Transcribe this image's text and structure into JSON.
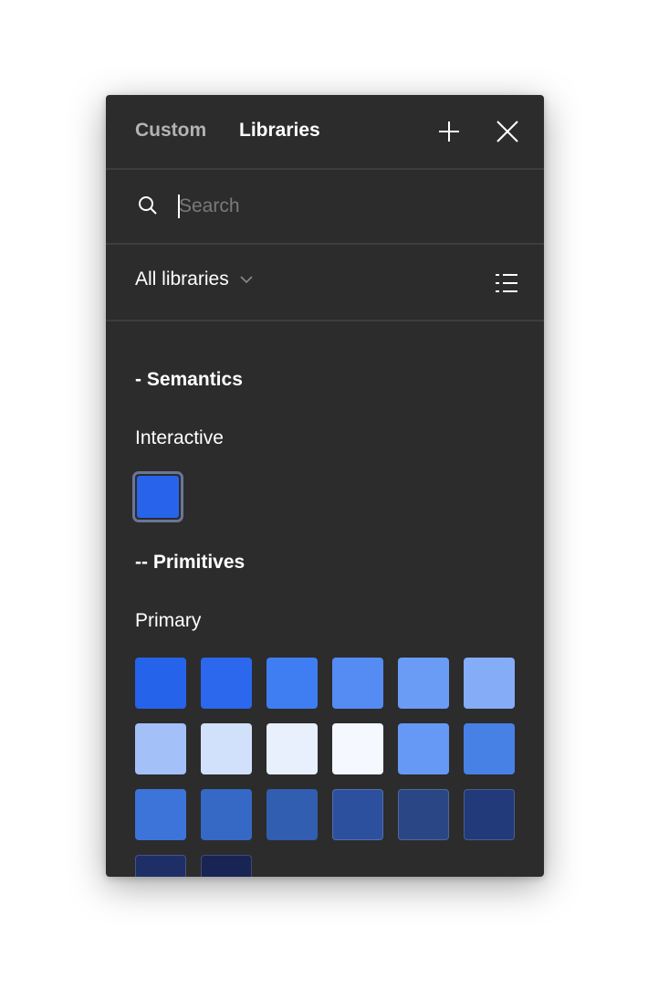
{
  "header": {
    "tabs": [
      {
        "label": "Custom",
        "active": false
      },
      {
        "label": "Libraries",
        "active": true
      }
    ],
    "add_icon": "plus-icon",
    "close_icon": "close-icon"
  },
  "search": {
    "placeholder": "Search",
    "value": "",
    "icon": "search-icon"
  },
  "filter": {
    "selected": "All libraries",
    "chevron_icon": "chevron-down-icon",
    "view_icon": "list-view-icon"
  },
  "groups": [
    {
      "title": "- Semantics",
      "subgroups": [
        {
          "title": "Interactive",
          "swatches": [
            {
              "color": "#2764eb",
              "selected": true
            }
          ]
        }
      ]
    },
    {
      "title": "-- Primitives",
      "subgroups": [
        {
          "title": "Primary",
          "swatches": [
            {
              "color": "#2563eb"
            },
            {
              "color": "#2b68ee"
            },
            {
              "color": "#3f7ef2"
            },
            {
              "color": "#558cf4"
            },
            {
              "color": "#6a9cf5"
            },
            {
              "color": "#84acf7"
            },
            {
              "color": "#a3c0f8"
            },
            {
              "color": "#d1e0fb"
            },
            {
              "color": "#e8effd"
            },
            {
              "color": "#f5f8fe"
            },
            {
              "color": "#6699f5"
            },
            {
              "color": "#4881e6"
            },
            {
              "color": "#3d74d9"
            },
            {
              "color": "#3668c5"
            },
            {
              "color": "#315eb0"
            },
            {
              "color": "#2c4f9e"
            },
            {
              "color": "#2a4685"
            },
            {
              "color": "#223a7a"
            },
            {
              "color": "#1d2f66"
            },
            {
              "color": "#182453"
            }
          ]
        }
      ]
    }
  ]
}
